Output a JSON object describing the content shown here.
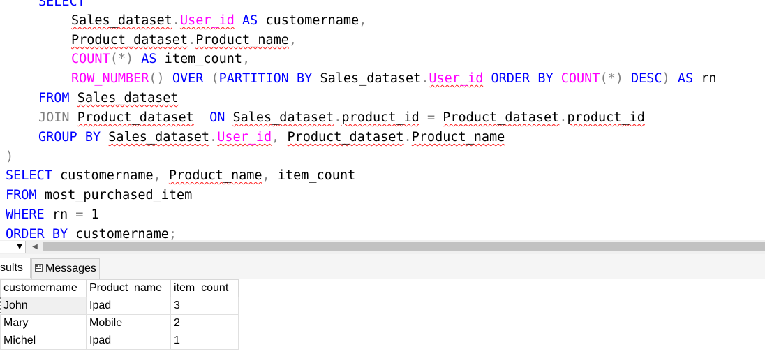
{
  "editor": {
    "lines": [
      [
        {
          "t": "SELECT",
          "c": "kw"
        }
      ],
      [
        {
          "t": "Sales_dataset",
          "c": "id",
          "sq": 1
        },
        {
          "t": ".",
          "c": "op"
        },
        {
          "t": "User_id",
          "c": "col",
          "sq": 1
        },
        {
          "t": " ",
          "c": "txt"
        },
        {
          "t": "AS",
          "c": "kw"
        },
        {
          "t": " customername",
          "c": "txt"
        },
        {
          "t": ",",
          "c": "op"
        }
      ],
      [
        {
          "t": "Product_dataset",
          "c": "id",
          "sq": 1
        },
        {
          "t": ".",
          "c": "op"
        },
        {
          "t": "Product_name",
          "c": "id",
          "sq": 1
        },
        {
          "t": ",",
          "c": "op"
        }
      ],
      [
        {
          "t": "COUNT",
          "c": "fn"
        },
        {
          "t": "(*)",
          "c": "op"
        },
        {
          "t": " ",
          "c": "txt"
        },
        {
          "t": "AS",
          "c": "kw"
        },
        {
          "t": " item_count",
          "c": "txt"
        },
        {
          "t": ",",
          "c": "op"
        }
      ],
      [
        {
          "t": "ROW_NUMBER",
          "c": "fn"
        },
        {
          "t": "()",
          "c": "op"
        },
        {
          "t": " ",
          "c": "txt"
        },
        {
          "t": "OVER",
          "c": "kw"
        },
        {
          "t": " ",
          "c": "txt"
        },
        {
          "t": "(",
          "c": "op"
        },
        {
          "t": "PARTITION BY",
          "c": "kw"
        },
        {
          "t": " Sales_dataset",
          "c": "id"
        },
        {
          "t": ".",
          "c": "op"
        },
        {
          "t": "User_id",
          "c": "col",
          "sq": 1
        },
        {
          "t": " ",
          "c": "txt"
        },
        {
          "t": "ORDER BY",
          "c": "kw"
        },
        {
          "t": " ",
          "c": "txt"
        },
        {
          "t": "COUNT",
          "c": "fn"
        },
        {
          "t": "(*)",
          "c": "op"
        },
        {
          "t": " ",
          "c": "txt"
        },
        {
          "t": "DESC",
          "c": "kw"
        },
        {
          "t": ")",
          "c": "op"
        },
        {
          "t": " ",
          "c": "txt"
        },
        {
          "t": "AS",
          "c": "kw"
        },
        {
          "t": " rn",
          "c": "txt"
        }
      ],
      [
        {
          "t": "FROM",
          "c": "kw"
        },
        {
          "t": " ",
          "c": "txt"
        },
        {
          "t": "Sales_dataset",
          "c": "id",
          "sq": 1
        }
      ],
      [
        {
          "t": "JOIN",
          "c": "op"
        },
        {
          "t": " ",
          "c": "txt"
        },
        {
          "t": "Product_dataset",
          "c": "id",
          "sq": 1
        },
        {
          "t": "  ",
          "c": "txt"
        },
        {
          "t": "ON",
          "c": "kw"
        },
        {
          "t": " ",
          "c": "txt"
        },
        {
          "t": "Sales_dataset",
          "c": "id",
          "sq": 1
        },
        {
          "t": ".",
          "c": "op"
        },
        {
          "t": "product_id",
          "c": "id",
          "sq": 1
        },
        {
          "t": " ",
          "c": "txt"
        },
        {
          "t": "=",
          "c": "op"
        },
        {
          "t": " ",
          "c": "txt"
        },
        {
          "t": "Product_dataset",
          "c": "id",
          "sq": 1
        },
        {
          "t": ".",
          "c": "op"
        },
        {
          "t": "product_id",
          "c": "id",
          "sq": 1
        }
      ],
      [
        {
          "t": "GROUP BY",
          "c": "kw"
        },
        {
          "t": " ",
          "c": "txt"
        },
        {
          "t": "Sales_dataset",
          "c": "id",
          "sq": 1
        },
        {
          "t": ".",
          "c": "op"
        },
        {
          "t": "User_id",
          "c": "col",
          "sq": 1
        },
        {
          "t": ",",
          "c": "op"
        },
        {
          "t": " ",
          "c": "txt"
        },
        {
          "t": "Product_dataset",
          "c": "id",
          "sq": 1
        },
        {
          "t": ".",
          "c": "op"
        },
        {
          "t": "Product_name",
          "c": "id",
          "sq": 1
        }
      ],
      [
        {
          "t": ")",
          "c": "op"
        }
      ],
      [
        {
          "t": "SELECT",
          "c": "kw"
        },
        {
          "t": " customername",
          "c": "txt"
        },
        {
          "t": ",",
          "c": "op"
        },
        {
          "t": " ",
          "c": "txt"
        },
        {
          "t": "Product_name",
          "c": "id",
          "sq": 1
        },
        {
          "t": ",",
          "c": "op"
        },
        {
          "t": " item_count",
          "c": "txt"
        }
      ],
      [
        {
          "t": "FROM",
          "c": "kw"
        },
        {
          "t": " most_purchased_item",
          "c": "txt"
        }
      ],
      [
        {
          "t": "WHERE",
          "c": "kw"
        },
        {
          "t": " rn ",
          "c": "txt"
        },
        {
          "t": "=",
          "c": "op"
        },
        {
          "t": " 1",
          "c": "num"
        }
      ],
      [
        {
          "t": "ORDER BY",
          "c": "kw"
        },
        {
          "t": " customername",
          "c": "txt"
        },
        {
          "t": ";",
          "c": "op"
        }
      ]
    ]
  },
  "tabs": {
    "results_label": "sults",
    "messages_label": "Messages"
  },
  "grid": {
    "columns": [
      "customername",
      "Product_name",
      "item_count"
    ],
    "rows": [
      [
        "John",
        "Ipad",
        "3"
      ],
      [
        "Mary",
        "Mobile",
        "2"
      ],
      [
        "Michel",
        "Ipad",
        "1"
      ]
    ]
  }
}
